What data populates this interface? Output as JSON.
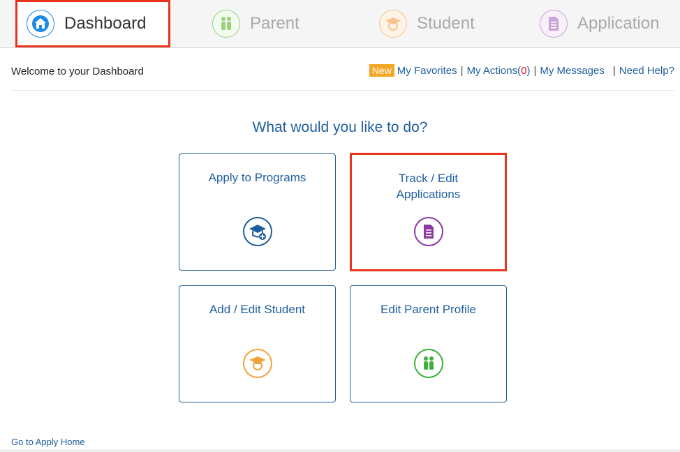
{
  "tabs": [
    {
      "label": "Dashboard",
      "icon": "home-icon",
      "active": true,
      "color": "#1e88e5"
    },
    {
      "label": "Parent",
      "icon": "parent-icon",
      "active": false,
      "color": "#3db03a"
    },
    {
      "label": "Student",
      "icon": "student-icon",
      "active": false,
      "color": "#f0a33a"
    },
    {
      "label": "Application",
      "icon": "application-icon",
      "active": false,
      "color": "#8e3aa5"
    }
  ],
  "welcome": "Welcome to your Dashboard",
  "toplinks": {
    "new_badge": "New",
    "favorites": "My Favorites",
    "actions": "My Actions(",
    "actions_count": "0",
    "actions_close": ")",
    "messages": "My Messages",
    "help": "Need Help?"
  },
  "question": "What would you like to do?",
  "cards": [
    {
      "title": "Apply to Programs",
      "icon": "graduation-cap-plus-icon"
    },
    {
      "title": "Track / Edit Applications",
      "icon": "document-icon"
    },
    {
      "title": "Add / Edit Student",
      "icon": "student-icon"
    },
    {
      "title": "Edit Parent Profile",
      "icon": "parent-icon"
    }
  ],
  "footer_link": "Go to Apply Home",
  "colors": {
    "accent": "#1f5f9e",
    "highlight": "#e8341c",
    "badge": "#f5a623"
  }
}
